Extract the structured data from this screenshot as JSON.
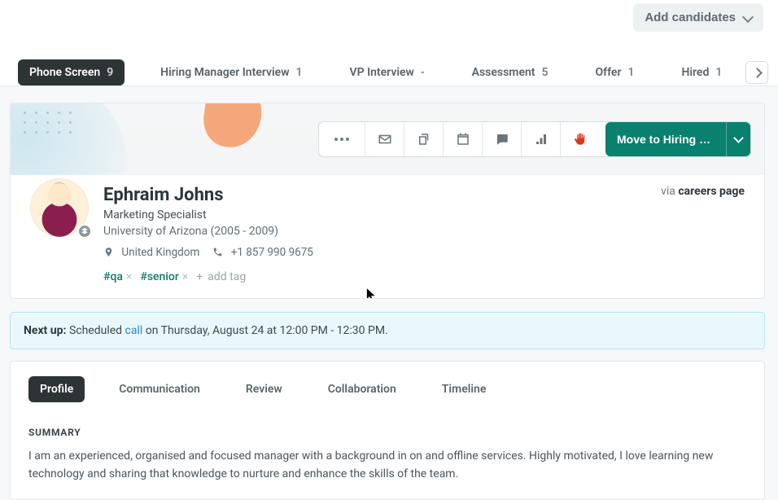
{
  "topbar": {
    "add_candidates_label": "Add candidates"
  },
  "stages": [
    {
      "label": "Phone Screen",
      "count": "9",
      "active": true
    },
    {
      "label": "Hiring Manager Interview",
      "count": "1",
      "active": false
    },
    {
      "label": "VP Interview",
      "count": "-",
      "active": false
    },
    {
      "label": "Assessment",
      "count": "5",
      "active": false
    },
    {
      "label": "Offer",
      "count": "1",
      "active": false
    },
    {
      "label": "Hired",
      "count": "1",
      "active": false
    }
  ],
  "toolbar": {
    "move_label": "Move to Hiring Mana…"
  },
  "candidate": {
    "name": "Ephraim Johns",
    "title": "Marketing Specialist",
    "education": "University of Arizona (2005 - 2009)",
    "location": "United Kingdom",
    "phone": "+1 857 990 9675",
    "source_prefix": "via ",
    "source_link": "careers page",
    "tags": [
      "#qa",
      "#senior"
    ],
    "add_tag_label": "add tag"
  },
  "next_up": {
    "label": "Next up:",
    "prefix": "Scheduled ",
    "link": "call",
    "suffix": " on Thursday, August 24 at 12:00 PM - 12:30 PM."
  },
  "profile_tabs": [
    "Profile",
    "Communication",
    "Review",
    "Collaboration",
    "Timeline"
  ],
  "profile_active_tab": "Profile",
  "summary": {
    "heading": "SUMMARY",
    "text": "I am an experienced, organised and focused manager with a background in on and offline services. Highly motivated, I love learning new technology and sharing that knowledge to nurture and enhance the skills of the team."
  }
}
